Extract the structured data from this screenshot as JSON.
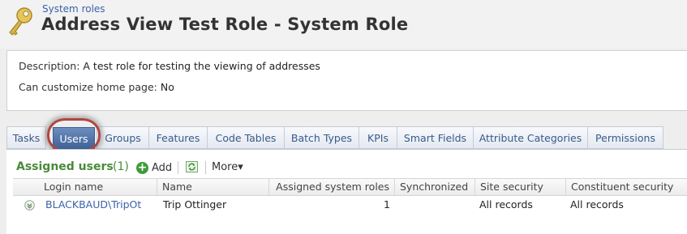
{
  "header": {
    "breadcrumb": "System roles",
    "title": "Address View Test Role - System Role",
    "icon": "key-icon"
  },
  "details": {
    "description_label": "Description:",
    "description_value": "A test role for testing the viewing of addresses",
    "home_label": "Can customize home page:",
    "home_value": "No"
  },
  "tabs": [
    {
      "label": "Tasks"
    },
    {
      "label": "Users",
      "active": true
    },
    {
      "label": "Groups"
    },
    {
      "label": "Features"
    },
    {
      "label": "Code Tables"
    },
    {
      "label": "Batch Types"
    },
    {
      "label": "KPIs"
    },
    {
      "label": "Smart Fields"
    },
    {
      "label": "Attribute Categories"
    },
    {
      "label": "Permissions"
    }
  ],
  "section": {
    "title": "Assigned users",
    "count": "(1)",
    "add_label": "Add",
    "more_label": "More▾"
  },
  "grid": {
    "columns": [
      "Login name",
      "Name",
      "Assigned system roles",
      "Synchronized",
      "Site security",
      "Constituent security"
    ],
    "rows": [
      {
        "login": "BLACKBAUD\\TripOt",
        "name": "Trip Ottinger",
        "roles": "1",
        "synchronized": "",
        "site_security": "All records",
        "constituent_security": "All records"
      }
    ]
  },
  "colors": {
    "accent_blue": "#3b62a8",
    "section_green": "#4a8a3a",
    "active_tab": "#4a6ea3",
    "highlight_ring": "#b0463e"
  }
}
